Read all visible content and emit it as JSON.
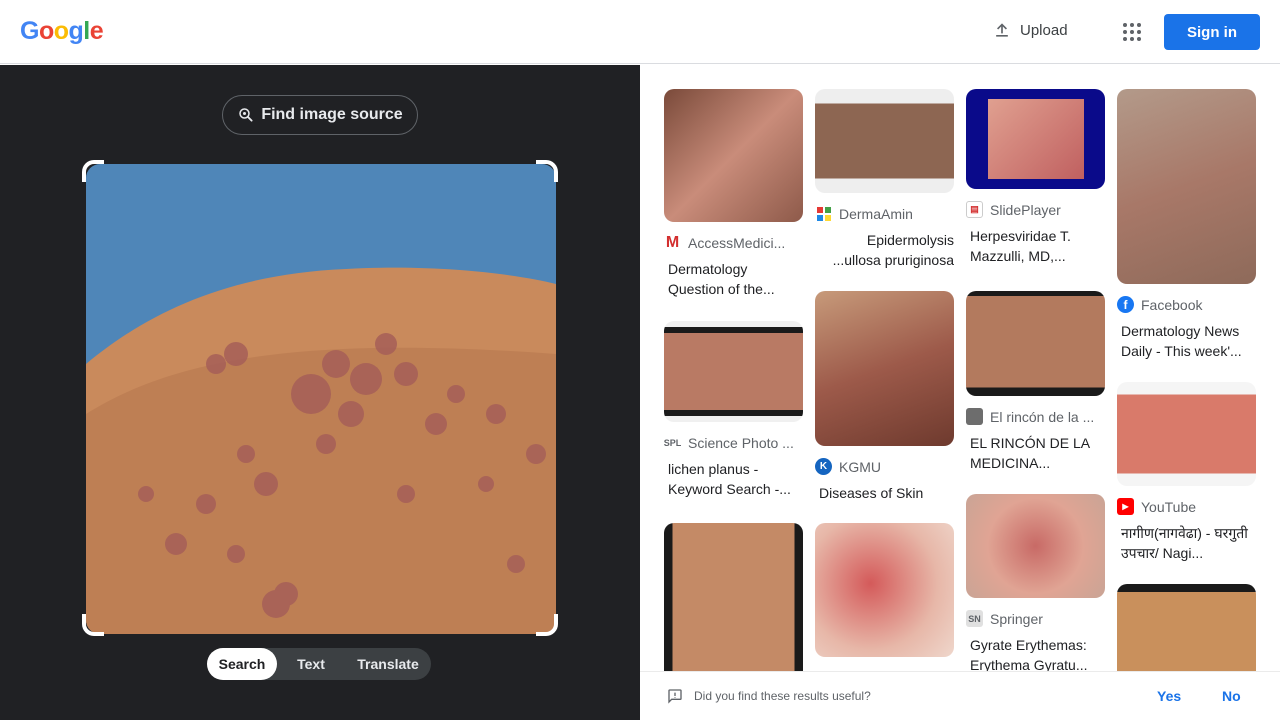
{
  "header": {
    "logo_letters": [
      "G",
      "o",
      "o",
      "g",
      "l",
      "e"
    ],
    "upload_label": "Upload",
    "signin_label": "Sign in"
  },
  "left_panel": {
    "find_source_label": "Find image source",
    "modes": [
      "Search",
      "Text",
      "Translate"
    ],
    "active_mode": "Search"
  },
  "results": [
    {
      "source": "AccessMedici...",
      "title": "Dermatology Question of the...",
      "icon": "access-medicine-icon"
    },
    {
      "source": "DermaAmin",
      "title": "Epidermolysis ...ullosa pruriginosa",
      "icon": "dermaamin-icon"
    },
    {
      "source": "SlidePlayer",
      "title": "Herpesviridae T. Mazzulli, MD,...",
      "icon": "slideplayer-icon"
    },
    {
      "source": "Facebook",
      "title": "Dermatology News Daily - This week'...",
      "icon": "facebook-icon"
    },
    {
      "source": "Science Photo ...",
      "title": "lichen planus - Keyword Search -...",
      "icon": "science-photo-icon"
    },
    {
      "source": "KGMU",
      "title": "Diseases of Skin",
      "icon": "kgmu-icon"
    },
    {
      "source": "El rincón de la ...",
      "title": "EL RINCÓN DE LA MEDICINA...",
      "icon": "el-rincon-icon"
    },
    {
      "source": "YouTube",
      "title": "नागीण(नागवेढा) - घरगुती उपचार/ Nagi...",
      "icon": "youtube-icon"
    },
    {
      "source": "Springer",
      "title": "Gyrate Erythemas: Erythema Gyratu...",
      "icon": "springer-icon"
    }
  ],
  "feedback": {
    "question": "Did you find these results useful?",
    "yes": "Yes",
    "no": "No"
  },
  "colors": {
    "accent": "#1a73e8",
    "left_bg": "#202124"
  }
}
